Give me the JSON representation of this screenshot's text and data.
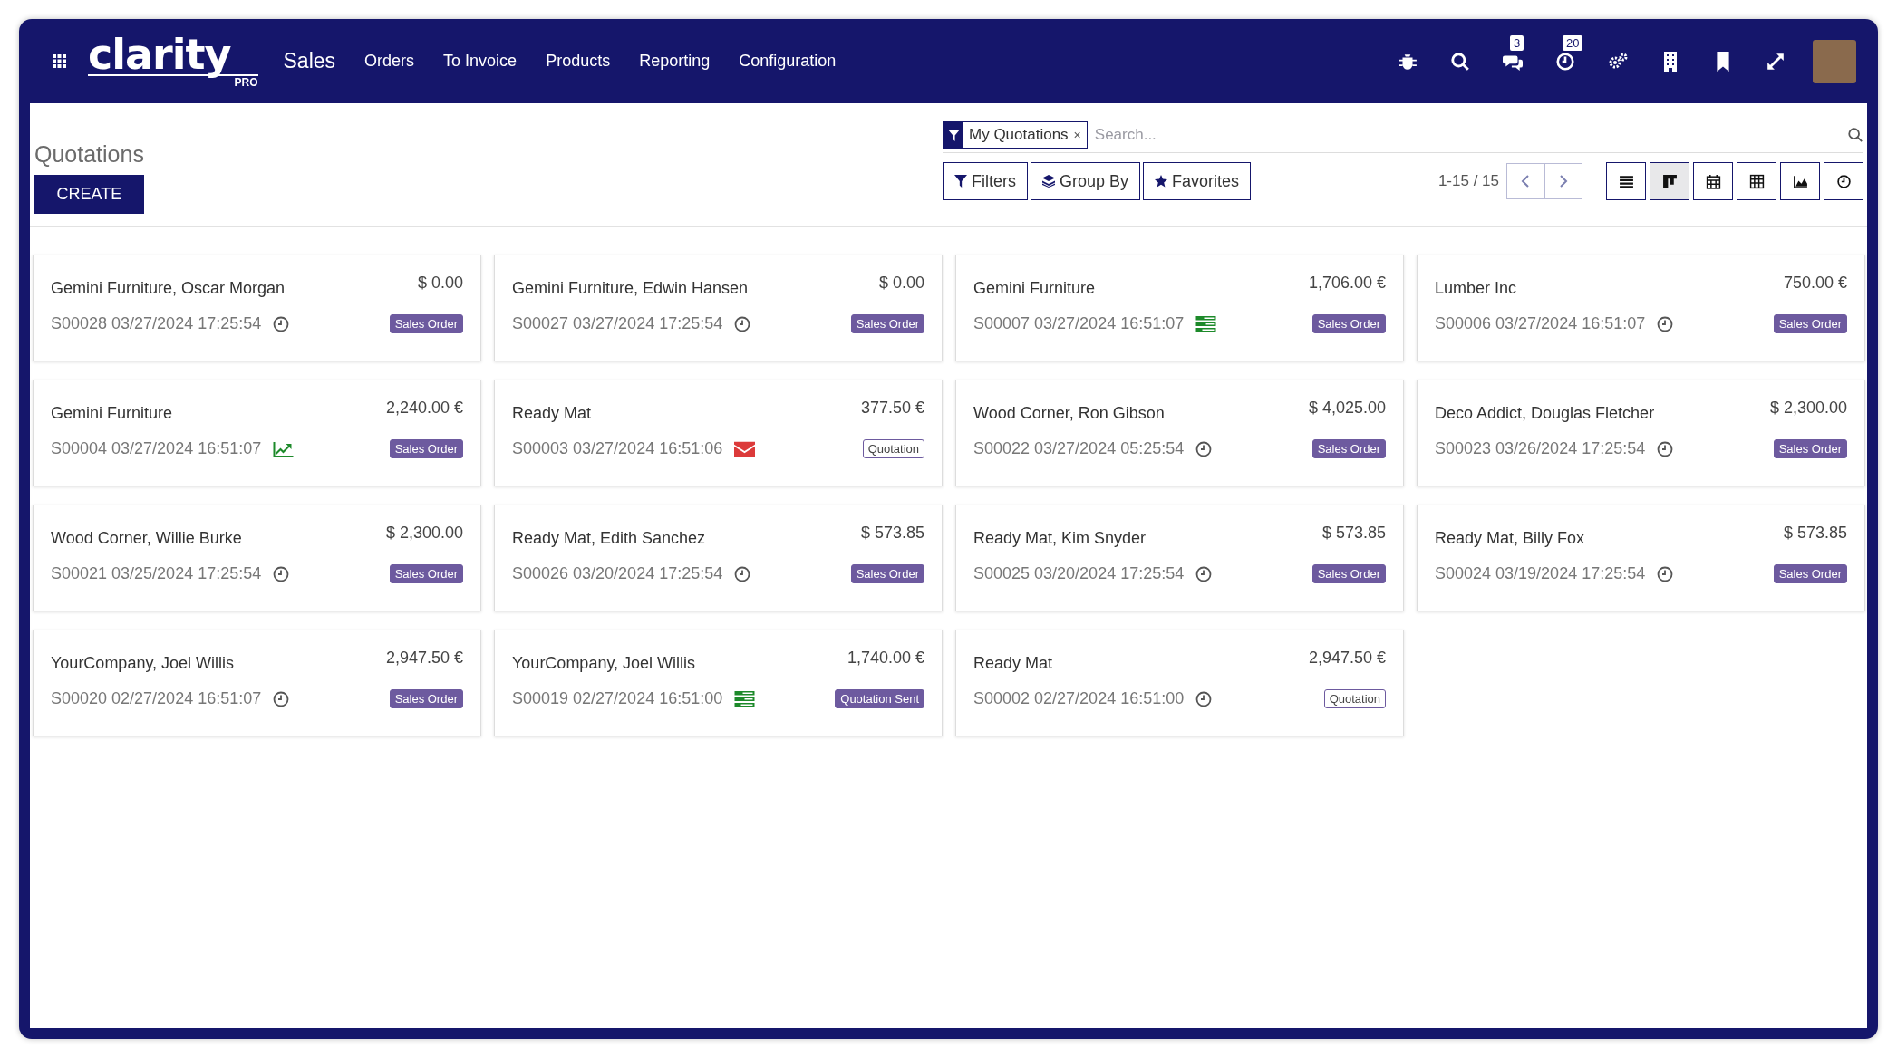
{
  "navbar": {
    "logo": "clarity",
    "logo_sub": "PRO",
    "app": "Sales",
    "menu": [
      "Orders",
      "To Invoice",
      "Products",
      "Reporting",
      "Configuration"
    ],
    "messages_count": "3",
    "activities_count": "20"
  },
  "control_panel": {
    "title": "Quotations",
    "create": "CREATE",
    "facet": "My Quotations",
    "facet_remove": "×",
    "search": {
      "placeholder": "Search..."
    },
    "filters": "Filters",
    "group_by": "Group By",
    "favorites": "Favorites",
    "pager": "1-15 / 15",
    "views": [
      {
        "kind": "list",
        "selected": false
      },
      {
        "kind": "kanban",
        "selected": true
      },
      {
        "kind": "calendar",
        "selected": false
      },
      {
        "kind": "pivot",
        "selected": false
      },
      {
        "kind": "graph",
        "selected": false
      },
      {
        "kind": "activity",
        "selected": false
      }
    ]
  },
  "cards": [
    {
      "customer": "Gemini Furniture, Oscar Morgan",
      "amount": "$ 0.00",
      "reference": "S00028 03/27/2024 17:25:54",
      "activity": {
        "kind": "clock"
      },
      "status": {
        "label": "Sales Order",
        "kind": "solid"
      }
    },
    {
      "customer": "Gemini Furniture, Edwin Hansen",
      "amount": "$ 0.00",
      "reference": "S00027 03/27/2024 17:25:54",
      "activity": {
        "kind": "clock"
      },
      "status": {
        "label": "Sales Order",
        "kind": "solid"
      }
    },
    {
      "customer": "Gemini Furniture",
      "amount": "1,706.00 €",
      "reference": "S00007 03/27/2024 16:51:07",
      "activity": {
        "kind": "tasks"
      },
      "status": {
        "label": "Sales Order",
        "kind": "solid"
      }
    },
    {
      "customer": "Lumber Inc",
      "amount": "750.00 €",
      "reference": "S00006 03/27/2024 16:51:07",
      "activity": {
        "kind": "clock"
      },
      "status": {
        "label": "Sales Order",
        "kind": "solid"
      }
    },
    {
      "customer": "Gemini Furniture",
      "amount": "2,240.00 €",
      "reference": "S00004 03/27/2024 16:51:07",
      "activity": {
        "kind": "trend"
      },
      "status": {
        "label": "Sales Order",
        "kind": "solid"
      }
    },
    {
      "customer": "Ready Mat",
      "amount": "377.50 €",
      "reference": "S00003 03/27/2024 16:51:06",
      "activity": {
        "kind": "mail"
      },
      "status": {
        "label": "Quotation",
        "kind": "outline"
      }
    },
    {
      "customer": "Wood Corner, Ron Gibson",
      "amount": "$ 4,025.00",
      "reference": "S00022 03/27/2024 05:25:54",
      "activity": {
        "kind": "clock"
      },
      "status": {
        "label": "Sales Order",
        "kind": "solid"
      }
    },
    {
      "customer": "Deco Addict, Douglas Fletcher",
      "amount": "$ 2,300.00",
      "reference": "S00023 03/26/2024 17:25:54",
      "activity": {
        "kind": "clock"
      },
      "status": {
        "label": "Sales Order",
        "kind": "solid"
      }
    },
    {
      "customer": "Wood Corner, Willie Burke",
      "amount": "$ 2,300.00",
      "reference": "S00021 03/25/2024 17:25:54",
      "activity": {
        "kind": "clock"
      },
      "status": {
        "label": "Sales Order",
        "kind": "solid"
      }
    },
    {
      "customer": "Ready Mat, Edith Sanchez",
      "amount": "$ 573.85",
      "reference": "S00026 03/20/2024 17:25:54",
      "activity": {
        "kind": "clock"
      },
      "status": {
        "label": "Sales Order",
        "kind": "solid"
      }
    },
    {
      "customer": "Ready Mat, Kim Snyder",
      "amount": "$ 573.85",
      "reference": "S00025 03/20/2024 17:25:54",
      "activity": {
        "kind": "clock"
      },
      "status": {
        "label": "Sales Order",
        "kind": "solid"
      }
    },
    {
      "customer": "Ready Mat, Billy Fox",
      "amount": "$ 573.85",
      "reference": "S00024 03/19/2024 17:25:54",
      "activity": {
        "kind": "clock"
      },
      "status": {
        "label": "Sales Order",
        "kind": "solid"
      }
    },
    {
      "customer": "YourCompany, Joel Willis",
      "amount": "2,947.50 €",
      "reference": "S00020 02/27/2024 16:51:07",
      "activity": {
        "kind": "clock"
      },
      "status": {
        "label": "Sales Order",
        "kind": "solid"
      }
    },
    {
      "customer": "YourCompany, Joel Willis",
      "amount": "1,740.00 €",
      "reference": "S00019 02/27/2024 16:51:00",
      "activity": {
        "kind": "tasks"
      },
      "status": {
        "label": "Quotation Sent",
        "kind": "solid"
      }
    },
    {
      "customer": "Ready Mat",
      "amount": "2,947.50 €",
      "reference": "S00002 02/27/2024 16:51:00",
      "activity": {
        "kind": "clock"
      },
      "status": {
        "label": "Quotation",
        "kind": "outline"
      }
    }
  ]
}
